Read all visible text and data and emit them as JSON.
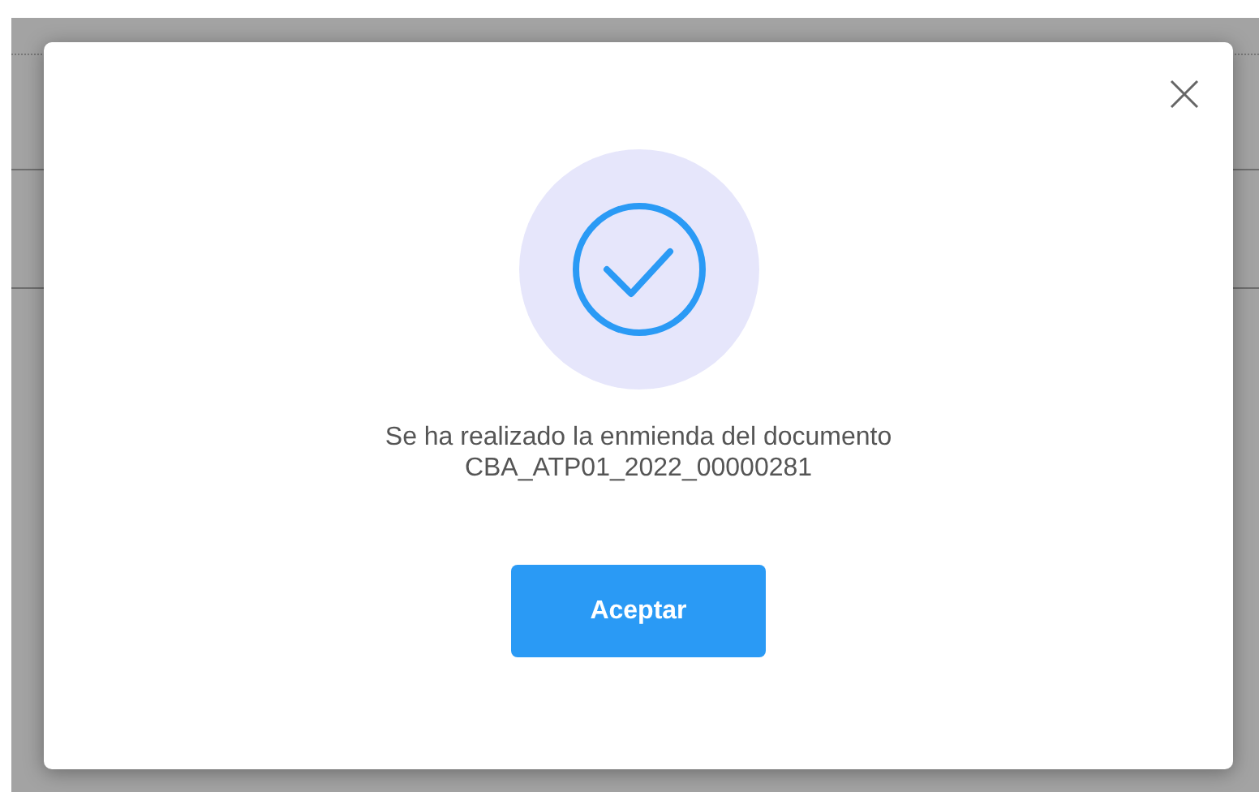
{
  "dialog": {
    "message_lines": [
      "Se ha realizado la enmienda del documento",
      "CBA_ATP01_2022_00000281"
    ],
    "buttons": [
      {
        "label": "Aceptar",
        "kind": "primary"
      }
    ]
  }
}
